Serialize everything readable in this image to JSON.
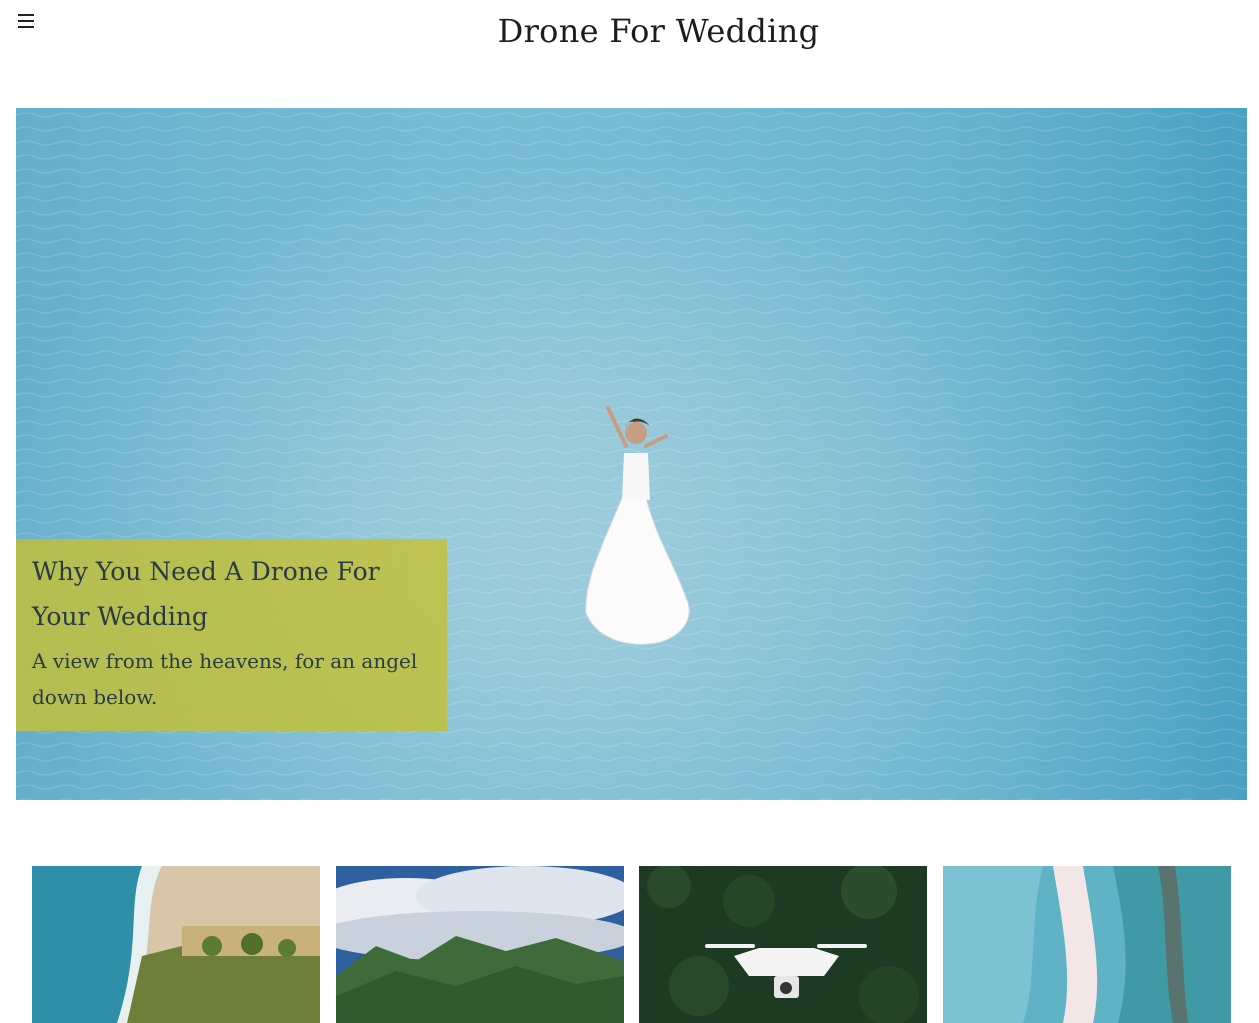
{
  "header": {
    "site_title": "Drone For Wedding",
    "menu_icon": "hamburger-menu-icon"
  },
  "hero": {
    "title": "Why You Need A Drone For Your Wedding",
    "subtitle": "A view from the heavens, for an angel down below.",
    "caption_color": "#c4bf34",
    "image": "aerial-bride-on-beach-image"
  },
  "thumbnails": [
    {
      "image": "aerial-coastline-image"
    },
    {
      "image": "mountain-clouds-image"
    },
    {
      "image": "white-drone-over-forest-image"
    },
    {
      "image": "aerial-sandbar-lagoon-image"
    }
  ],
  "colors": {
    "water_light": "#8fc8dc",
    "water_deep": "#4a9ec4",
    "sand": "#eef0ef",
    "caption_text": "#2a3a45"
  }
}
